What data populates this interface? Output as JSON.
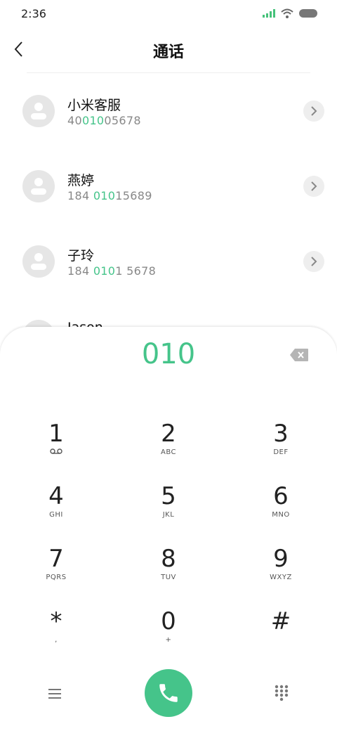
{
  "status": {
    "time": "2:36"
  },
  "header": {
    "title": "通话"
  },
  "contacts": [
    {
      "name": "小米客服",
      "num_pre": "40",
      "num_match": "010",
      "num_post": "05678"
    },
    {
      "name": "燕婷",
      "num_pre": "184 ",
      "num_match": "010",
      "num_post": "15689"
    },
    {
      "name": "子玲",
      "num_pre": "184 ",
      "num_match": "010",
      "num_post": "1 5678"
    },
    {
      "name": "Jason",
      "num_pre": "",
      "num_match": "",
      "num_post": ""
    }
  ],
  "dialer": {
    "number": "010",
    "keys": [
      {
        "digit": "1",
        "sub": "voicemail-icon"
      },
      {
        "digit": "2",
        "sub": "ABC"
      },
      {
        "digit": "3",
        "sub": "DEF"
      },
      {
        "digit": "4",
        "sub": "GHI"
      },
      {
        "digit": "5",
        "sub": "JKL"
      },
      {
        "digit": "6",
        "sub": "MNO"
      },
      {
        "digit": "7",
        "sub": "PQRS"
      },
      {
        "digit": "8",
        "sub": "TUV"
      },
      {
        "digit": "9",
        "sub": "WXYZ"
      },
      {
        "digit": "*",
        "sub": ","
      },
      {
        "digit": "0",
        "sub": "+"
      },
      {
        "digit": "#",
        "sub": ""
      }
    ]
  },
  "colors": {
    "accent": "#45c48a",
    "signal": "#45c27a"
  }
}
